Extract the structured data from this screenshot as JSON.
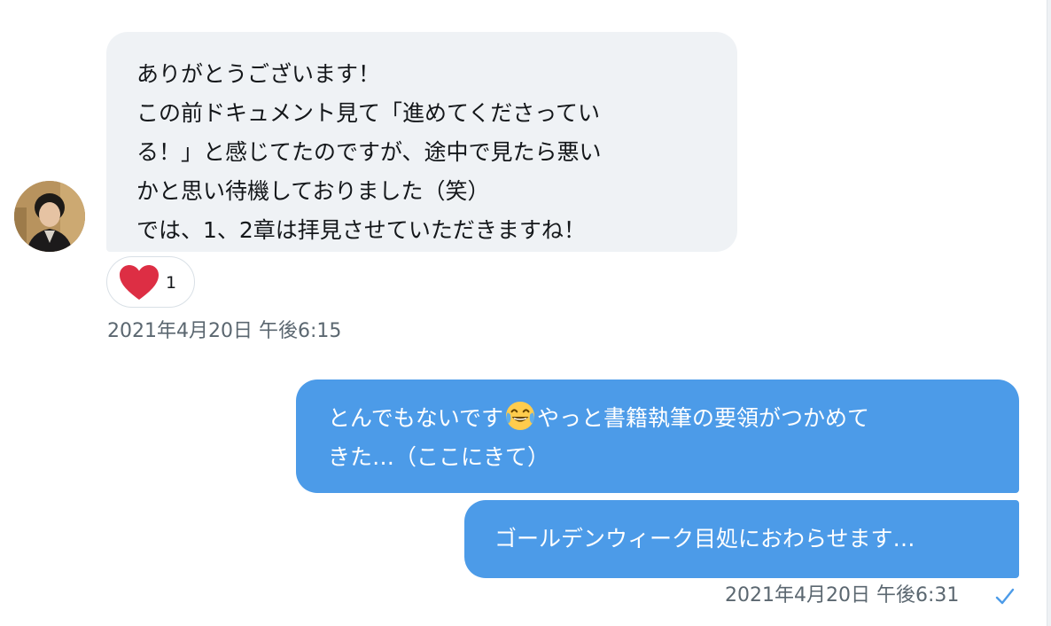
{
  "conversation": {
    "received": {
      "lines": [
        "ありがとうございます！",
        "この前ドキュメント見て「進めてくださってい",
        "る！」と感じてたのですが、途中で見たら悪い",
        "かと思い待機しておりました（笑）",
        "では、1、2章は拝見させていただきますね！"
      ],
      "reaction": {
        "icon": "heart-icon",
        "count": "1",
        "color": "#e0245e"
      },
      "timestamp": "2021年4月20日 午後6:15"
    },
    "sent": [
      {
        "line1_before_emoji": "とんでもないです",
        "emoji": "face-with-tears-of-joy-icon",
        "line1_after_emoji": "やっと書籍執筆の要領がつかめて",
        "line2": "きた…（ここにきて）"
      },
      {
        "line1": "ゴールデンウィーク目処におわらせます…"
      }
    ],
    "sent_timestamp": "2021年4月20日 午後6:31",
    "read_status_icon": "checkmark-icon"
  },
  "colors": {
    "sent_bubble": "#4c9be8",
    "received_bubble": "#eff2f5",
    "timestamp_text": "#5b6770",
    "check": "#4c9be8"
  }
}
